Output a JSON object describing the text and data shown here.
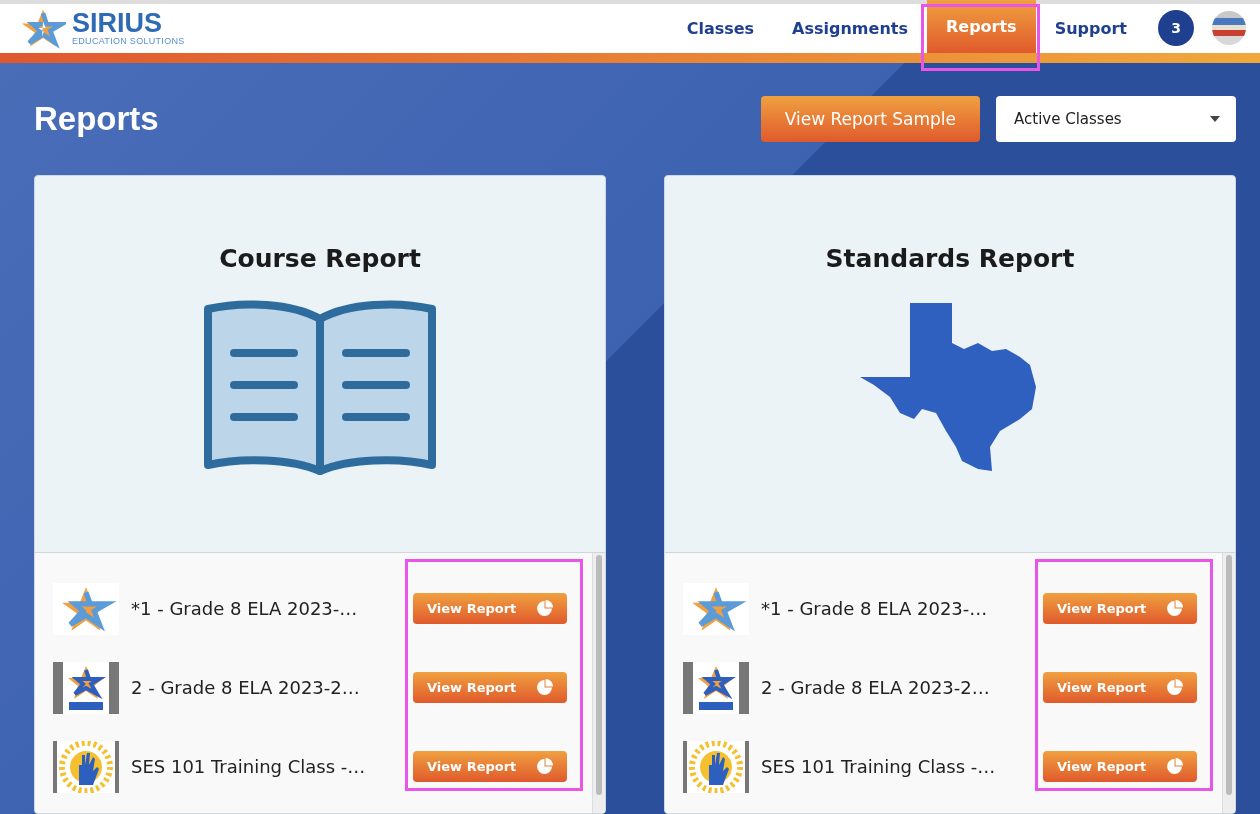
{
  "logo": {
    "name": "SIRIUS",
    "tagline": "EDUCATION SOLUTIONS"
  },
  "nav": [
    {
      "label": "Classes",
      "selected": false,
      "highlighted": false
    },
    {
      "label": "Assignments",
      "selected": false,
      "highlighted": false
    },
    {
      "label": "Reports",
      "selected": true,
      "highlighted": true
    },
    {
      "label": "Support",
      "selected": false,
      "highlighted": false
    }
  ],
  "notification_count": "3",
  "page_title": "Reports",
  "sample_button": "View Report Sample",
  "class_filter": {
    "value": "Active Classes"
  },
  "cards": [
    {
      "title": "Course Report",
      "kind": "book",
      "buttons_highlighted": true,
      "classes": [
        {
          "name": "*1 - Grade 8 ELA 2023-…",
          "kind": "star",
          "button": "View Report"
        },
        {
          "name": "2 - Grade 8 ELA 2023-2…",
          "kind": "sirius",
          "button": "View Report"
        },
        {
          "name": "SES 101 Training Class -…",
          "kind": "sun",
          "button": "View Report"
        }
      ]
    },
    {
      "title": "Standards Report",
      "kind": "map",
      "buttons_highlighted": true,
      "classes": [
        {
          "name": "*1 - Grade 8 ELA 2023-…",
          "kind": "star",
          "button": "View Report"
        },
        {
          "name": "2 - Grade 8 ELA 2023-2…",
          "kind": "sirius",
          "button": "View Report"
        },
        {
          "name": "SES 101 Training Class -…",
          "kind": "sun",
          "button": "View Report"
        }
      ]
    }
  ]
}
